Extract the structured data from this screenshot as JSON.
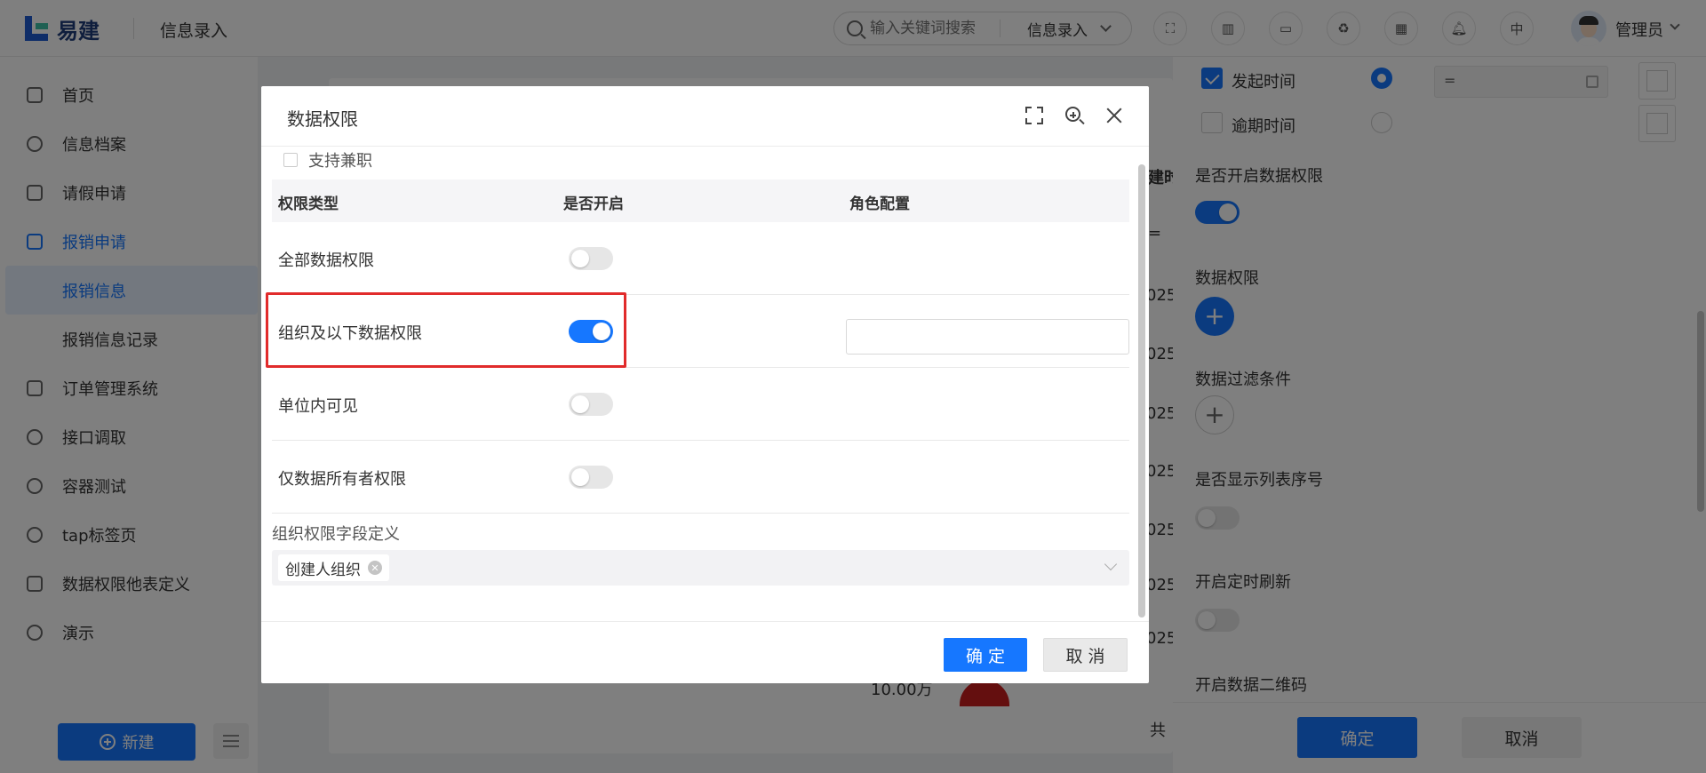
{
  "header": {
    "logo_text": "易建",
    "title": "信息录入",
    "search_placeholder": "输入关键词搜索",
    "search_scope": "信息录入",
    "lang": "中",
    "user_name": "管理员"
  },
  "sidebar": {
    "items": [
      {
        "label": "首页",
        "icon": "home-icon"
      },
      {
        "label": "信息档案",
        "icon": "user-icon"
      },
      {
        "label": "请假申请",
        "icon": "checklist-icon"
      },
      {
        "label": "报销申请",
        "icon": "monitor-icon"
      },
      {
        "label": "报销信息"
      },
      {
        "label": "报销信息记录"
      },
      {
        "label": "订单管理系统",
        "icon": "calendar-icon"
      },
      {
        "label": "接口调取",
        "icon": "compass-icon"
      },
      {
        "label": "容器测试",
        "icon": "compass-icon"
      },
      {
        "label": "tap标签页",
        "icon": "clock-icon"
      },
      {
        "label": "数据权限他表定义",
        "icon": "clipboard-icon"
      },
      {
        "label": "演示",
        "icon": "compass-icon"
      }
    ],
    "new_button": "新建"
  },
  "background": {
    "col_header_fragment": "建时",
    "filter_fragment": "=",
    "year_fragment": "025",
    "amount_fragment": "10.00万",
    "pager_fragment": "共"
  },
  "drawer": {
    "start_time_label": "发起时间",
    "overdue_time_label": "逾期时间",
    "filter_value": "=",
    "enable_data_perm_label": "是否开启数据权限",
    "data_perm_label": "数据权限",
    "data_filter_label": "数据过滤条件",
    "show_index_label": "是否显示列表序号",
    "auto_refresh_label": "开启定时刷新",
    "qr_label": "开启数据二维码",
    "ok": "确定",
    "cancel": "取消"
  },
  "modal": {
    "title": "数据权限",
    "support_part_time": "支持兼职",
    "columns": [
      "权限类型",
      "是否开启",
      "角色配置"
    ],
    "rows": [
      {
        "name": "全部数据权限",
        "enabled": false
      },
      {
        "name": "组织及以下数据权限",
        "enabled": true
      },
      {
        "name": "单位内可见",
        "enabled": false
      },
      {
        "name": "仅数据所有者权限",
        "enabled": false
      }
    ],
    "field_label": "组织权限字段定义",
    "tag": "创建人组织",
    "ok": "确 定",
    "cancel": "取 消"
  },
  "colors": {
    "primary": "#1677ff",
    "highlight": "#e12b2b"
  }
}
